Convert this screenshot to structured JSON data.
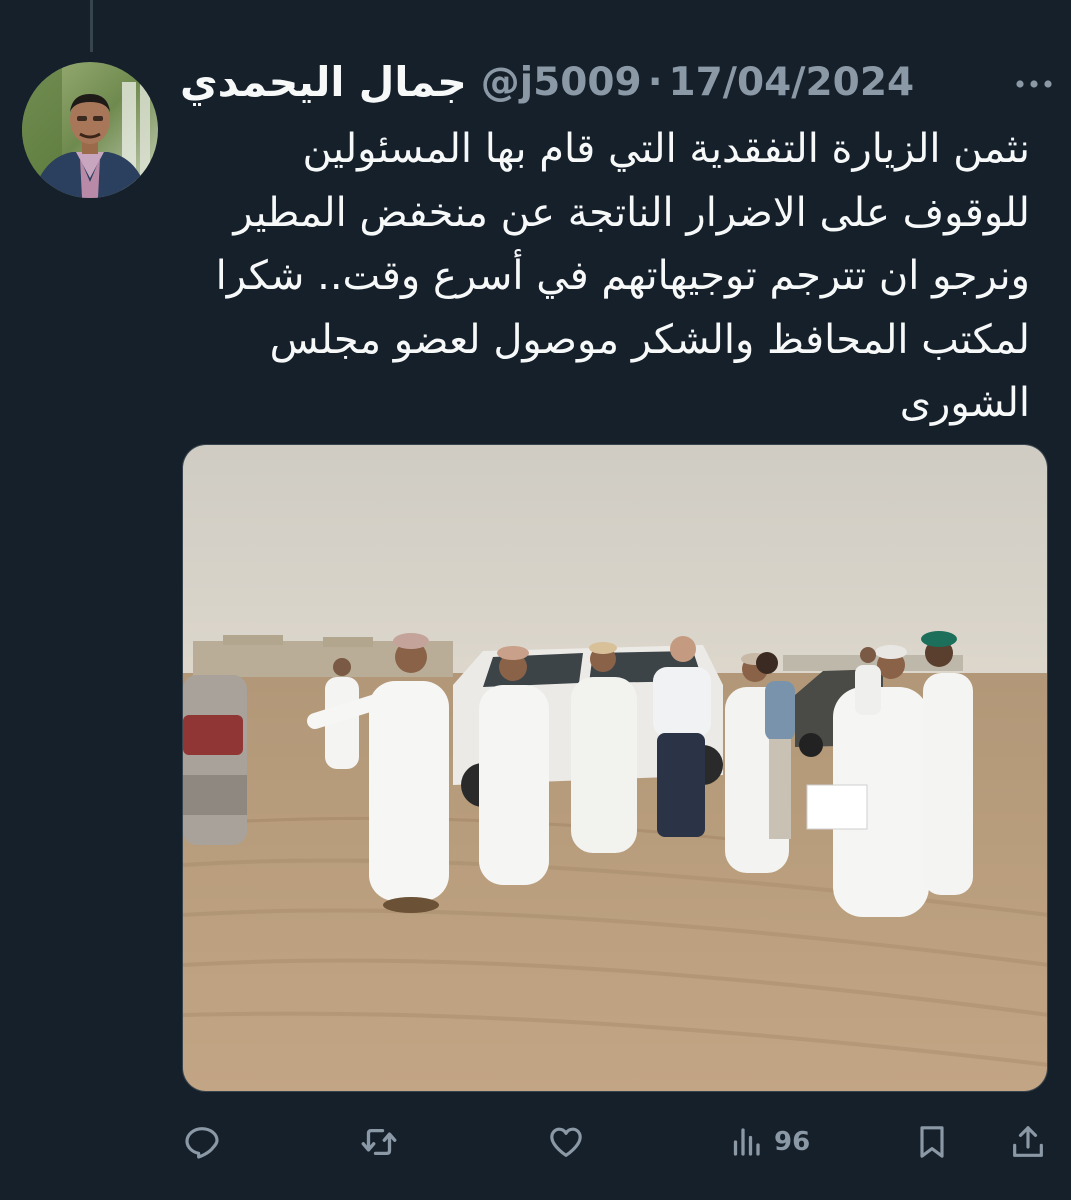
{
  "tweet": {
    "author": {
      "display_name": "جمال اليحمدي",
      "handle": "@j5009",
      "separator": "·"
    },
    "date": "17/04/2024",
    "text": "نثمن الزيارة التفقدية التي قام بها المسئولين للوقوف على الاضرار الناتجة عن منخفض المطير ونرجو ان تترجم توجيهاتهم في أسرع وقت.. شكرا لمكتب المحافظ والشكر موصول لعضو مجلس الشورى",
    "media": {
      "kind": "photo"
    },
    "actions": {
      "reply_icon": "reply-icon",
      "retweet_icon": "retweet-icon",
      "like_icon": "heart-icon",
      "views_icon": "views-icon",
      "views_count": "96",
      "bookmark_icon": "bookmark-icon",
      "share_icon": "share-icon",
      "more_icon": "more-icon"
    }
  },
  "colors": {
    "background": "#15202b",
    "text_primary": "#f7f9f9",
    "text_secondary": "#8b98a5",
    "border": "#38444d"
  }
}
